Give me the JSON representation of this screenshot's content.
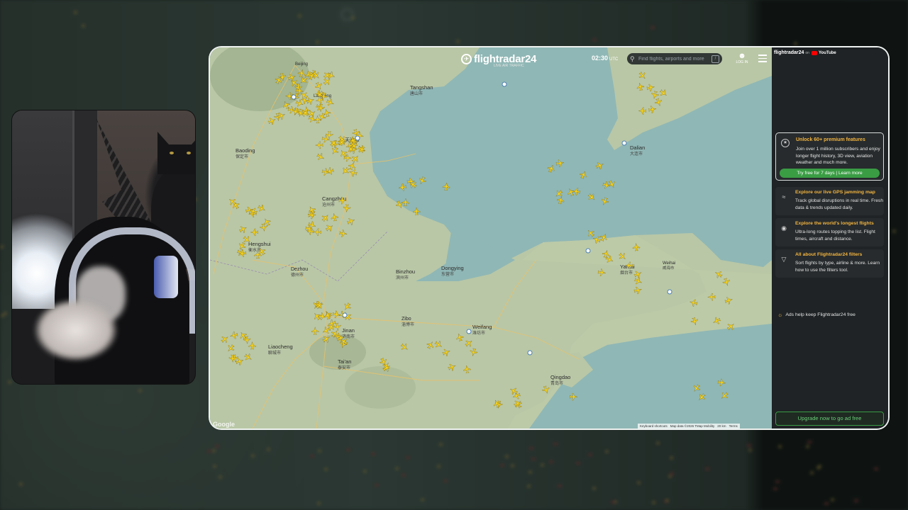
{
  "header": {
    "logo_text": "flightradar24",
    "logo_subtitle": "LIVE AIR TRAFFIC",
    "time": "02:30",
    "time_zone": "UTC",
    "search_placeholder": "Find flights, airports and more",
    "search_shortcut": "/",
    "login_label": "LOG IN"
  },
  "map": {
    "cities": [
      {
        "name": "Beijing",
        "zh": "北京市"
      },
      {
        "name": "Tangshan",
        "zh": "唐山市"
      },
      {
        "name": "Langfang",
        "zh": "廊坊市"
      },
      {
        "name": "Baoding",
        "zh": "保定市"
      },
      {
        "name": "Tianjin",
        "zh": "天津市"
      },
      {
        "name": "Cangzhou",
        "zh": "沧州市"
      },
      {
        "name": "Hengshui",
        "zh": "衡水市"
      },
      {
        "name": "Dezhou",
        "zh": "德州市"
      },
      {
        "name": "Binzhou",
        "zh": "滨州市"
      },
      {
        "name": "Dongying",
        "zh": "东营市"
      },
      {
        "name": "Dalian",
        "zh": "大连市"
      },
      {
        "name": "Yantai",
        "zh": "烟台市"
      },
      {
        "name": "Weihai",
        "zh": "威海市"
      },
      {
        "name": "Weifang",
        "zh": "潍坊市"
      },
      {
        "name": "Zibo",
        "zh": "淄博市"
      },
      {
        "name": "Jinan",
        "zh": "济南市"
      },
      {
        "name": "Liaocheng",
        "zh": "聊城市"
      },
      {
        "name": "Tai'an",
        "zh": "泰安市"
      },
      {
        "name": "Qingdao",
        "zh": "青岛市"
      }
    ],
    "attribution": {
      "shortcuts": "Keyboard shortcuts",
      "data": "Map data ©2026 TMap Mobility",
      "scale": "20 km",
      "terms": "Terms"
    },
    "google_mark": "Google"
  },
  "sidebar": {
    "brand": "flightradar24",
    "on": "on",
    "youtube": "YouTube",
    "promo": {
      "title": "Unlock 60+ premium features",
      "body": "Join over 1 million subscribers and enjoy longer flight history, 3D view, aviation weather and much more.",
      "cta": "Try free for 7 days | Learn more"
    },
    "features": [
      {
        "icon": "radar-icon",
        "title": "Explore our live GPS jamming map",
        "body": "Track global disruptions in real time. Fresh data & trends updated daily."
      },
      {
        "icon": "globe-icon",
        "title": "Explore the world's longest flights",
        "body": "Ultra-long routes topping the list. Flight times, aircraft and distance."
      },
      {
        "icon": "filter-icon",
        "title": "All about Flightradar24 filters",
        "body": "Sort flights by type, airline & more. Learn how to use the filters tool."
      }
    ],
    "ads_note": "Ads help keep Flightradar24 free",
    "upgrade": "Upgrade now to go ad free"
  },
  "colors": {
    "accent_orange": "#f3b540",
    "accent_green": "#3a9d44",
    "sea": "#8fb7b5",
    "land": "#b9c7a6",
    "aircraft": "#f6d31f"
  }
}
